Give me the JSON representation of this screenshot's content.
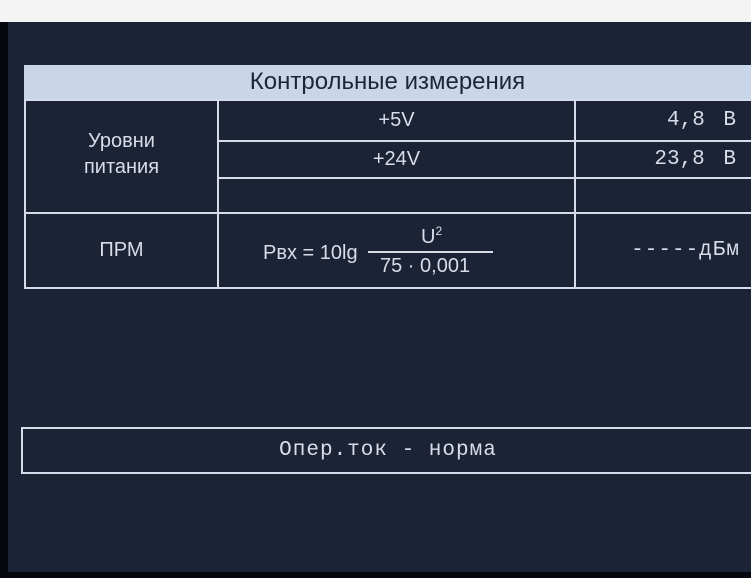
{
  "title": "Контрольные измерения",
  "power": {
    "label_line1": "Уровни",
    "label_line2": "питания",
    "rows": [
      {
        "name": "+5V",
        "value": "4,8 В"
      },
      {
        "name": "+24V",
        "value": "23,8 В"
      },
      {
        "name": "",
        "value": ""
      }
    ]
  },
  "prm": {
    "label": "ПРМ",
    "formula_lhs": "Pвх = 10lg",
    "formula_num": "U",
    "formula_exp": "2",
    "formula_den": "75 · 0,001",
    "value": "-----дБм"
  },
  "status": "Опер.ток - норма",
  "colors": {
    "background": "#1c2336",
    "title_bar": "#c9d6ea",
    "lines": "#d6dcea",
    "text": "#d8dde9"
  }
}
